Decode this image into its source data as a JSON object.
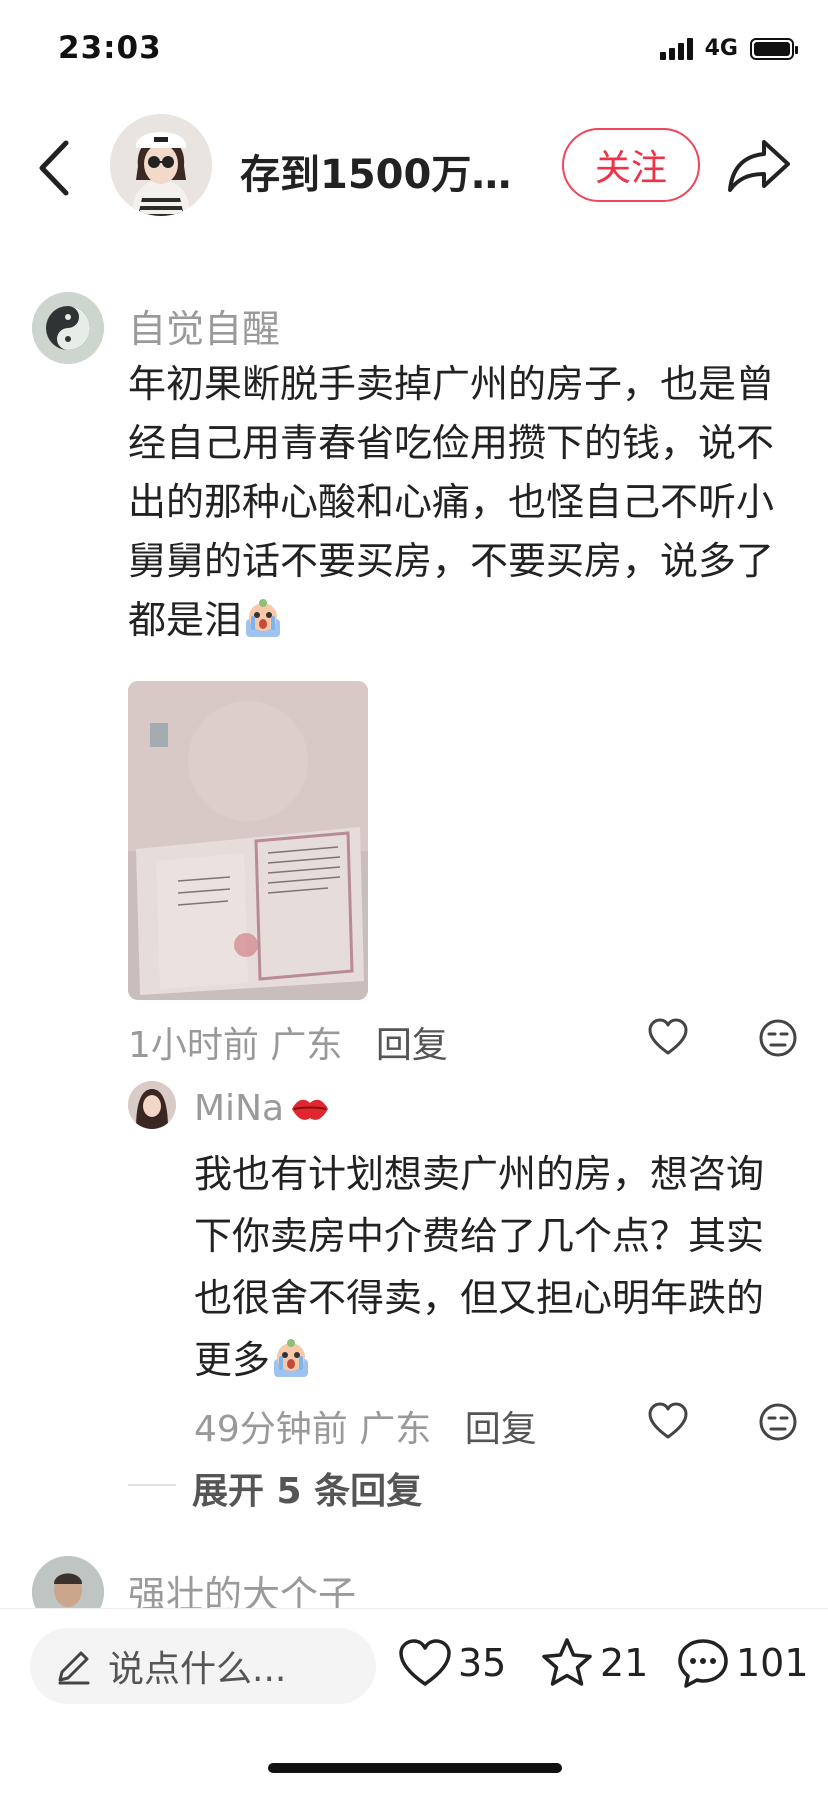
{
  "status_bar": {
    "time": "23:03",
    "network": "4G"
  },
  "header": {
    "title": "存到1500万…",
    "follow_label": "关注"
  },
  "comment": {
    "username": "自觉自醒",
    "text": "年初果断脱手卖掉广州的房子，也是曾经自己用青春省吃俭用攒下的钱，说不出的那种心酸和心痛，也怪自己不听小舅舅的话不要买房，不要买房，说多了都是泪",
    "time": "1小时前",
    "location": "广东",
    "reply_label": "回复"
  },
  "reply": {
    "username": "MiNa",
    "text": "我也有计划想卖广州的房，想咨询下你卖房中介费给了几个点？其实也很舍不得卖，但又担心明年跌的更多",
    "time": "49分钟前",
    "location": "广东",
    "reply_label": "回复"
  },
  "expand_label": "展开 5 条回复",
  "next_comment": {
    "username": "强壮的大个子"
  },
  "bottom_bar": {
    "input_placeholder": "说点什么...",
    "likes": "35",
    "favorites": "21",
    "comments": "101"
  },
  "icons": [
    "back-icon",
    "share-icon",
    "heart-icon",
    "dislike-face-icon",
    "crying-emoji-icon",
    "kiss-lips-icon",
    "pencil-icon",
    "star-icon",
    "chat-bubble-icon"
  ],
  "colors": {
    "accent": "#ee3248",
    "text": "#222222",
    "muted": "#999999"
  }
}
